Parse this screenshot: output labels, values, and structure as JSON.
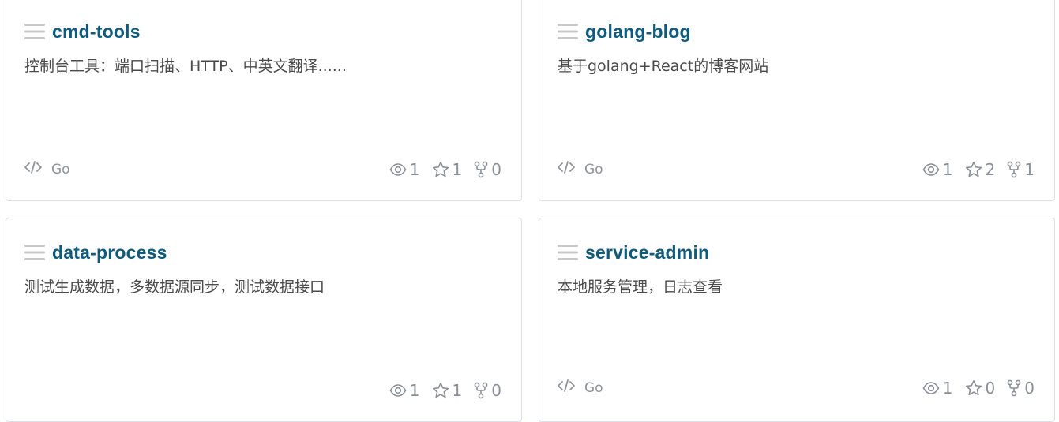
{
  "repos": [
    {
      "name": "cmd-tools",
      "description": "控制台工具：端口扫描、HTTP、中英文翻译......",
      "language": "Go",
      "watchers": "1",
      "stars": "1",
      "forks": "0"
    },
    {
      "name": "golang-blog",
      "description": "基于golang+React的博客网站",
      "language": "Go",
      "watchers": "1",
      "stars": "2",
      "forks": "1"
    },
    {
      "name": "data-process",
      "description": "测试生成数据，多数据源同步，测试数据接口",
      "language": "",
      "watchers": "1",
      "stars": "1",
      "forks": "0"
    },
    {
      "name": "service-admin",
      "description": "本地服务管理，日志查看",
      "language": "Go",
      "watchers": "1",
      "stars": "0",
      "forks": "0"
    }
  ],
  "icons": {
    "drag_handle": "drag-handle-icon",
    "language": "code-icon",
    "watchers": "eye-icon",
    "stars": "star-icon",
    "forks": "fork-icon"
  },
  "colors": {
    "title": "#0f5b7f",
    "muted": "#8a8f98",
    "border": "#dcdfe6",
    "handle": "#c8c8c8"
  }
}
